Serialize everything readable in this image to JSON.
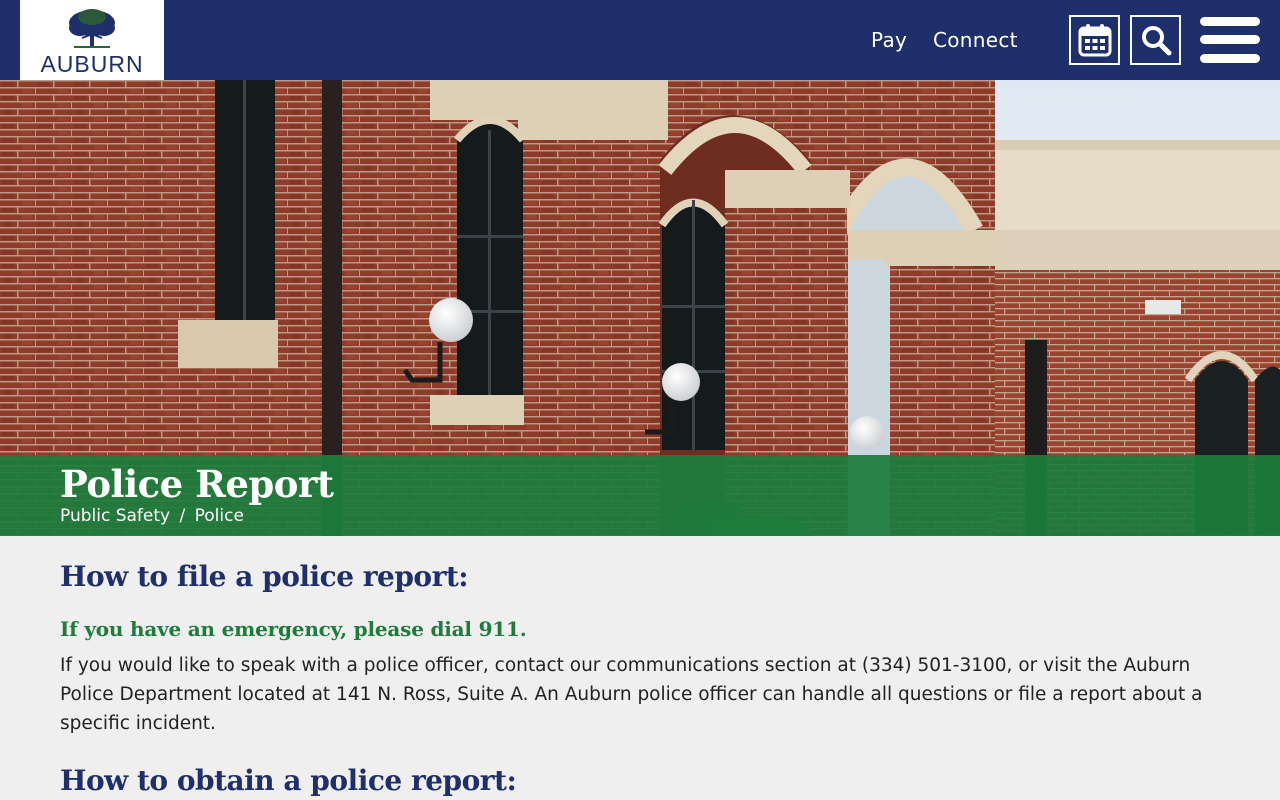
{
  "header": {
    "logo_text": "AUBURN",
    "nav": [
      {
        "label": "Pay"
      },
      {
        "label": "Connect"
      }
    ],
    "icons": [
      "calendar-icon",
      "search-icon",
      "menu-icon"
    ],
    "brand_color": "#1f2f6b"
  },
  "hero": {
    "title": "Police Report",
    "breadcrumb": {
      "parent": "Public Safety",
      "separator": "/",
      "current": "Police"
    },
    "band_color": "#1c7d3c"
  },
  "content": {
    "heading1": "How to file a police report:",
    "emergency": "If you have an emergency, please dial 911.",
    "paragraph": "If you would like to speak with a police officer, contact our communications section at (334) 501-3100, or visit the Auburn Police Department located at 141 N. Ross, Suite A. An Auburn police officer can handle all questions or file a report about a specific incident.",
    "heading2": "How to obtain a police report:"
  }
}
